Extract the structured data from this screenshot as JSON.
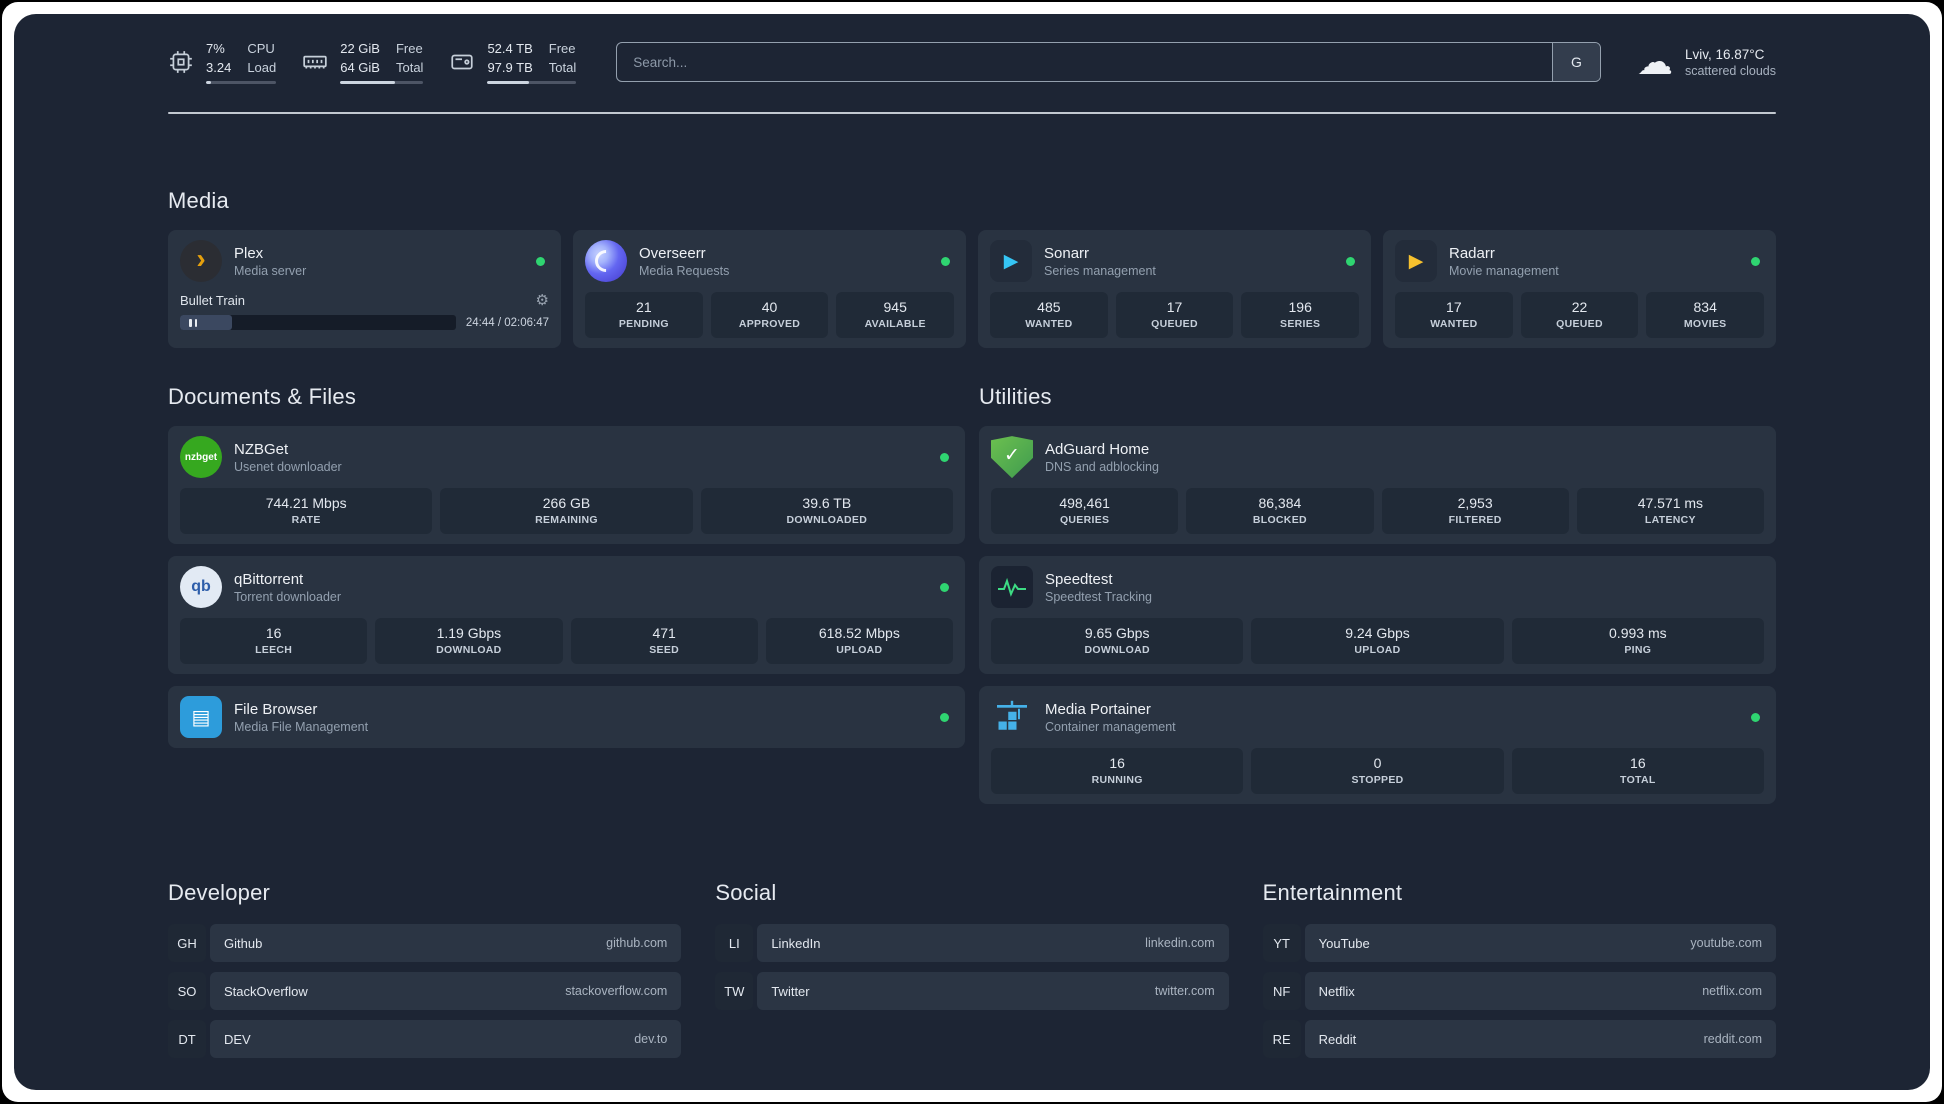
{
  "icons": {
    "plex": "›",
    "sonarr": "▶",
    "radarr": "▶",
    "nzbget": "nzbget",
    "qbittorrent": "qb",
    "filebrowser": "▤",
    "adguard_check": "✓",
    "gear": "⚙",
    "cloud": "☁"
  },
  "topbar": {
    "resources": [
      {
        "name": "cpu",
        "values": [
          "7%",
          "3.24"
        ],
        "labels": [
          "CPU",
          "Load"
        ],
        "progress": 7
      },
      {
        "name": "memory",
        "values": [
          "22 GiB",
          "64 GiB"
        ],
        "labels": [
          "Free",
          "Total"
        ],
        "progress": 66
      },
      {
        "name": "disk",
        "values": [
          "52.4 TB",
          "97.9 TB"
        ],
        "labels": [
          "Free",
          "Total"
        ],
        "progress": 47
      }
    ],
    "search": {
      "placeholder": "Search...",
      "button": "G"
    },
    "weather": {
      "location": "Lviv, 16.87°C",
      "condition": "scattered clouds"
    }
  },
  "sections": {
    "media": {
      "title": "Media",
      "services": [
        {
          "name": "Plex",
          "desc": "Media server",
          "online": true,
          "player": {
            "title": "Bullet Train",
            "time": "24:44 / 02:06:47",
            "progress": 19
          }
        },
        {
          "name": "Overseerr",
          "desc": "Media Requests",
          "online": true,
          "stats": [
            {
              "value": "21",
              "label": "PENDING"
            },
            {
              "value": "40",
              "label": "APPROVED"
            },
            {
              "value": "945",
              "label": "AVAILABLE"
            }
          ]
        },
        {
          "name": "Sonarr",
          "desc": "Series management",
          "online": true,
          "stats": [
            {
              "value": "485",
              "label": "WANTED"
            },
            {
              "value": "17",
              "label": "QUEUED"
            },
            {
              "value": "196",
              "label": "SERIES"
            }
          ]
        },
        {
          "name": "Radarr",
          "desc": "Movie management",
          "online": true,
          "stats": [
            {
              "value": "17",
              "label": "WANTED"
            },
            {
              "value": "22",
              "label": "QUEUED"
            },
            {
              "value": "834",
              "label": "MOVIES"
            }
          ]
        }
      ]
    },
    "documents": {
      "title": "Documents & Files",
      "services": [
        {
          "name": "NZBGet",
          "desc": "Usenet downloader",
          "online": true,
          "stats": [
            {
              "value": "744.21 Mbps",
              "label": "RATE"
            },
            {
              "value": "266 GB",
              "label": "REMAINING"
            },
            {
              "value": "39.6 TB",
              "label": "DOWNLOADED"
            }
          ]
        },
        {
          "name": "qBittorrent",
          "desc": "Torrent downloader",
          "online": true,
          "stats": [
            {
              "value": "16",
              "label": "LEECH"
            },
            {
              "value": "1.19 Gbps",
              "label": "DOWNLOAD"
            },
            {
              "value": "471",
              "label": "SEED"
            },
            {
              "value": "618.52 Mbps",
              "label": "UPLOAD"
            }
          ]
        },
        {
          "name": "File Browser",
          "desc": "Media File Management",
          "online": true
        }
      ]
    },
    "utilities": {
      "title": "Utilities",
      "services": [
        {
          "name": "AdGuard Home",
          "desc": "DNS and adblocking",
          "online": false,
          "stats": [
            {
              "value": "498,461",
              "label": "QUERIES"
            },
            {
              "value": "86,384",
              "label": "BLOCKED"
            },
            {
              "value": "2,953",
              "label": "FILTERED"
            },
            {
              "value": "47.571 ms",
              "label": "LATENCY"
            }
          ]
        },
        {
          "name": "Speedtest",
          "desc": "Speedtest Tracking",
          "online": false,
          "stats": [
            {
              "value": "9.65 Gbps",
              "label": "DOWNLOAD"
            },
            {
              "value": "9.24 Gbps",
              "label": "UPLOAD"
            },
            {
              "value": "0.993 ms",
              "label": "PING"
            }
          ]
        },
        {
          "name": "Media Portainer",
          "desc": "Container management",
          "online": true,
          "stats": [
            {
              "value": "16",
              "label": "RUNNING"
            },
            {
              "value": "0",
              "label": "STOPPED"
            },
            {
              "value": "16",
              "label": "TOTAL"
            }
          ]
        }
      ]
    }
  },
  "bookmarks": [
    {
      "title": "Developer",
      "items": [
        {
          "abbr": "GH",
          "name": "Github",
          "url": "github.com"
        },
        {
          "abbr": "SO",
          "name": "StackOverflow",
          "url": "stackoverflow.com"
        },
        {
          "abbr": "DT",
          "name": "DEV",
          "url": "dev.to"
        }
      ]
    },
    {
      "title": "Social",
      "items": [
        {
          "abbr": "LI",
          "name": "LinkedIn",
          "url": "linkedin.com"
        },
        {
          "abbr": "TW",
          "name": "Twitter",
          "url": "twitter.com"
        }
      ]
    },
    {
      "title": "Entertainment",
      "items": [
        {
          "abbr": "YT",
          "name": "YouTube",
          "url": "youtube.com"
        },
        {
          "abbr": "NF",
          "name": "Netflix",
          "url": "netflix.com"
        },
        {
          "abbr": "RE",
          "name": "Reddit",
          "url": "reddit.com"
        }
      ]
    }
  ]
}
